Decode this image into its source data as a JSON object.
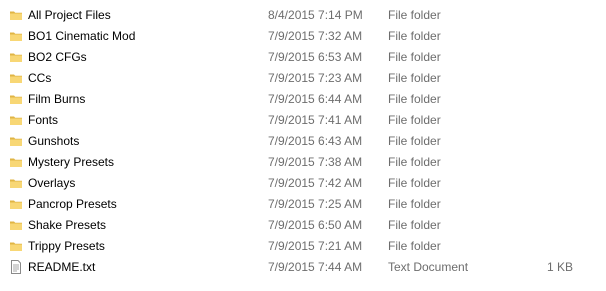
{
  "colors": {
    "folder_icon": "#f8d775",
    "folder_icon_dark": "#e0b545",
    "secondary_text": "#6d6d6d",
    "text_file_icon": "#8a8a8a"
  },
  "files": [
    {
      "name": "All Project Files",
      "date": "8/4/2015 7:14 PM",
      "type": "File folder",
      "size": "",
      "icon": "folder-icon"
    },
    {
      "name": "BO1 Cinematic Mod",
      "date": "7/9/2015 7:32 AM",
      "type": "File folder",
      "size": "",
      "icon": "folder-icon"
    },
    {
      "name": "BO2 CFGs",
      "date": "7/9/2015 6:53 AM",
      "type": "File folder",
      "size": "",
      "icon": "folder-icon"
    },
    {
      "name": "CCs",
      "date": "7/9/2015 7:23 AM",
      "type": "File folder",
      "size": "",
      "icon": "folder-icon"
    },
    {
      "name": "Film Burns",
      "date": "7/9/2015 6:44 AM",
      "type": "File folder",
      "size": "",
      "icon": "folder-icon"
    },
    {
      "name": "Fonts",
      "date": "7/9/2015 7:41 AM",
      "type": "File folder",
      "size": "",
      "icon": "folder-icon"
    },
    {
      "name": "Gunshots",
      "date": "7/9/2015 6:43 AM",
      "type": "File folder",
      "size": "",
      "icon": "folder-icon"
    },
    {
      "name": "Mystery Presets",
      "date": "7/9/2015 7:38 AM",
      "type": "File folder",
      "size": "",
      "icon": "folder-icon"
    },
    {
      "name": "Overlays",
      "date": "7/9/2015 7:42 AM",
      "type": "File folder",
      "size": "",
      "icon": "folder-icon"
    },
    {
      "name": "Pancrop Presets",
      "date": "7/9/2015 7:25 AM",
      "type": "File folder",
      "size": "",
      "icon": "folder-icon"
    },
    {
      "name": "Shake Presets",
      "date": "7/9/2015 6:50 AM",
      "type": "File folder",
      "size": "",
      "icon": "folder-icon"
    },
    {
      "name": "Trippy Presets",
      "date": "7/9/2015 7:21 AM",
      "type": "File folder",
      "size": "",
      "icon": "folder-icon"
    },
    {
      "name": "README.txt",
      "date": "7/9/2015 7:44 AM",
      "type": "Text Document",
      "size": "1 KB",
      "icon": "text-file-icon"
    }
  ]
}
